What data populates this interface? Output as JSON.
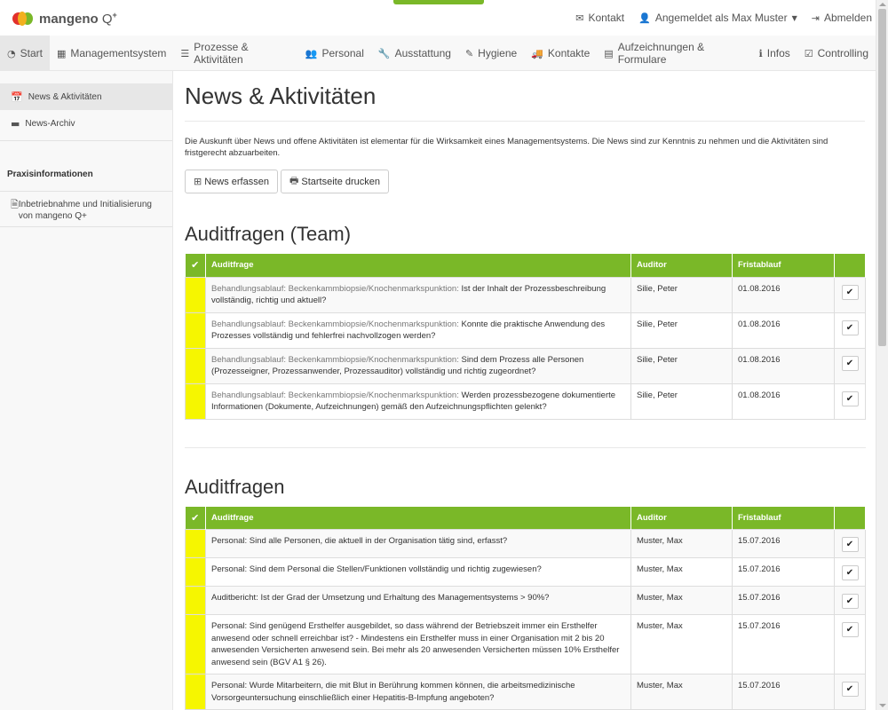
{
  "brand": {
    "name": "mangeno",
    "product": "Q",
    "sup": "+"
  },
  "topnav": {
    "contact": "Kontakt",
    "logged_in": "Angemeldet als Max Muster",
    "logout": "Abmelden"
  },
  "mainnav": [
    {
      "label": "Start",
      "icon": "dashboard-icon"
    },
    {
      "label": "Managementsystem",
      "icon": "table-icon"
    },
    {
      "label": "Prozesse & Aktivitäten",
      "icon": "list-icon"
    },
    {
      "label": "Personal",
      "icon": "users-icon"
    },
    {
      "label": "Ausstattung",
      "icon": "wrench-icon"
    },
    {
      "label": "Hygiene",
      "icon": "edit-icon"
    },
    {
      "label": "Kontakte",
      "icon": "truck-icon"
    },
    {
      "label": "Aufzeichnungen & Formulare",
      "icon": "list-alt-icon"
    },
    {
      "label": "Infos",
      "icon": "info-icon"
    },
    {
      "label": "Controlling",
      "icon": "check-square-icon"
    }
  ],
  "sidebar": {
    "items": [
      {
        "label": "News & Aktivitäten"
      },
      {
        "label": "News-Archiv"
      }
    ],
    "heading": "Praxisinformationen",
    "link": "Inbetriebnahme und Initialisierung von mangeno Q+"
  },
  "page": {
    "title": "News & Aktivitäten",
    "intro": "Die Auskunft über News und offene Aktivitäten ist elementar für die Wirksamkeit eines Managementsystems. Die News sind zur Kenntnis zu nehmen und die Aktivitäten sind fristgerecht abzuarbeiten.",
    "btn_news": "News erfassen",
    "btn_print": "Startseite drucken"
  },
  "columns": {
    "question": "Auditfrage",
    "auditor": "Auditor",
    "deadline": "Fristablauf"
  },
  "team_section": {
    "title": "Auditfragen (Team)",
    "rows": [
      {
        "prefix": "Behandlungsablauf: Beckenkammbiopsie/Knochenmarkspunktion:",
        "text": "Ist der Inhalt der Prozessbeschreibung vollständig, richtig und aktuell?",
        "auditor": "Silie, Peter",
        "deadline": "01.08.2016"
      },
      {
        "prefix": "Behandlungsablauf: Beckenkammbiopsie/Knochenmarkspunktion:",
        "text": "Konnte die praktische Anwendung des Prozesses vollständig und fehlerfrei nachvollzogen werden?",
        "auditor": "Silie, Peter",
        "deadline": "01.08.2016"
      },
      {
        "prefix": "Behandlungsablauf: Beckenkammbiopsie/Knochenmarkspunktion:",
        "text": "Sind dem Prozess alle Personen (Prozesseigner, Prozessanwender, Prozessauditor) vollständig und richtig zugeordnet?",
        "auditor": "Silie, Peter",
        "deadline": "01.08.2016"
      },
      {
        "prefix": "Behandlungsablauf: Beckenkammbiopsie/Knochenmarkspunktion:",
        "text": "Werden prozessbezogene dokumentierte Informationen (Dokumente, Aufzeichnungen) gemäß den Aufzeichnungspflichten gelenkt?",
        "auditor": "Silie, Peter",
        "deadline": "01.08.2016"
      }
    ]
  },
  "audit_section": {
    "title": "Auditfragen",
    "rows": [
      {
        "text": "Personal: Sind alle Personen, die aktuell in der Organisation tätig sind, erfasst?",
        "auditor": "Muster, Max",
        "deadline": "15.07.2016"
      },
      {
        "text": "Personal: Sind dem Personal die Stellen/Funktionen vollständig und richtig zugewiesen?",
        "auditor": "Muster, Max",
        "deadline": "15.07.2016"
      },
      {
        "text": "Auditbericht: Ist der Grad der Umsetzung und Erhaltung des Managementsystems > 90%?",
        "auditor": "Muster, Max",
        "deadline": "15.07.2016"
      },
      {
        "text": "Personal: Sind genügend Ersthelfer ausgebildet, so dass während der Betriebszeit immer ein Ersthelfer anwesend oder schnell erreichbar ist? - Mindestens ein Ersthelfer muss in einer Organisation mit 2 bis 20 anwesenden Versicherten anwesend sein. Bei mehr als 20 anwesenden Versicherten müssen 10% Ersthelfer anwesend sein (BGV A1 § 26).",
        "auditor": "Muster, Max",
        "deadline": "15.07.2016"
      },
      {
        "text": "Personal: Wurde Mitarbeitern, die mit Blut in Berührung kommen können, die arbeitsmedizinische Vorsorgeuntersuchung einschließlich einer Hepatitis-B-Impfung angeboten?",
        "auditor": "Muster, Max",
        "deadline": "15.07.2016"
      },
      {
        "text": "",
        "auditor": "",
        "deadline": ""
      }
    ]
  },
  "colors": {
    "accent": "#7ab828",
    "flag": "#f6f600"
  }
}
